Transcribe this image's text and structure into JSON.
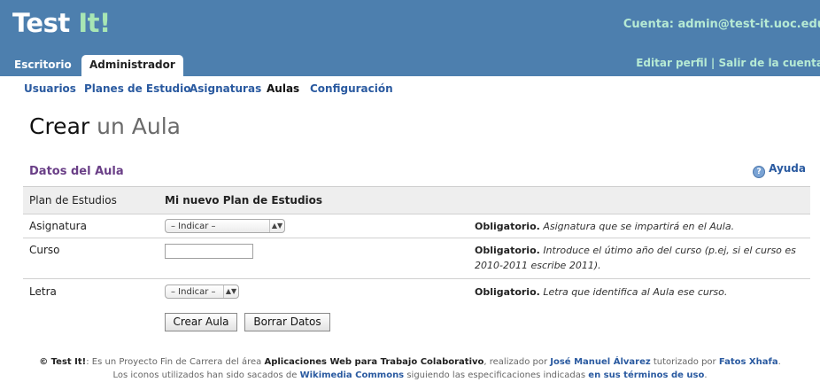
{
  "header": {
    "logo_main": "Test",
    "logo_accent": "It!",
    "account": "Cuenta: admin@test-it.uoc.edu"
  },
  "tabs": [
    "Escritorio",
    "Administrador"
  ],
  "user_links": {
    "edit_profile": "Editar perfil",
    "separator": "|",
    "logout": "Salir de la cuenta"
  },
  "subnav": [
    "Usuarios",
    "Planes de Estudio",
    "Asignaturas",
    "Aulas",
    "Configuración"
  ],
  "title": {
    "part1": "Crear",
    "part2": "un Aula"
  },
  "section": {
    "title": "Datos del Aula",
    "help": "Ayuda"
  },
  "form": {
    "plan_label": "Plan de Estudios",
    "plan_value": "Mi nuevo Plan de Estudios",
    "asignatura_label": "Asignatura",
    "asignatura_select": "– Indicar –",
    "asignatura_req": "Obligatorio.",
    "asignatura_hint": "Asignatura que se impartirá en el Aula.",
    "curso_label": "Curso",
    "curso_value": "",
    "curso_req": "Obligatorio.",
    "curso_hint_1": "Introduce el útimo año del curso (p.ej, si el curso es",
    "curso_hint_2": "2010-2011 escribe 2011).",
    "letra_label": "Letra",
    "letra_select": "– Indicar –",
    "letra_req": "Obligatorio.",
    "letra_hint": "Letra que identifica al Aula ese curso.",
    "submit": "Crear Aula",
    "reset": "Borrar Datos"
  },
  "footer": {
    "brand": "© Test It!",
    "t1": ": Es un Proyecto Fin de Carrera del área",
    "area": "Aplicaciones Web para Trabajo Colaborativo",
    "t2": ", realizado por",
    "author": "José Manuel Álvarez",
    "t3": "tutorizado por",
    "tutor": "Fatos Xhafa",
    "t4": ".",
    "l2_1": "Los iconos utilizados han sido sacados de",
    "commons": "Wikimedia Commons",
    "l2_2": "siguiendo las especificaciones indicadas",
    "terms": "en sus términos de uso",
    "l2_3": "."
  },
  "colors": {
    "banner": "#4d7fae",
    "accent": "#a8e6b4",
    "section_title": "#6a3f87",
    "link": "#2a5aa0"
  }
}
